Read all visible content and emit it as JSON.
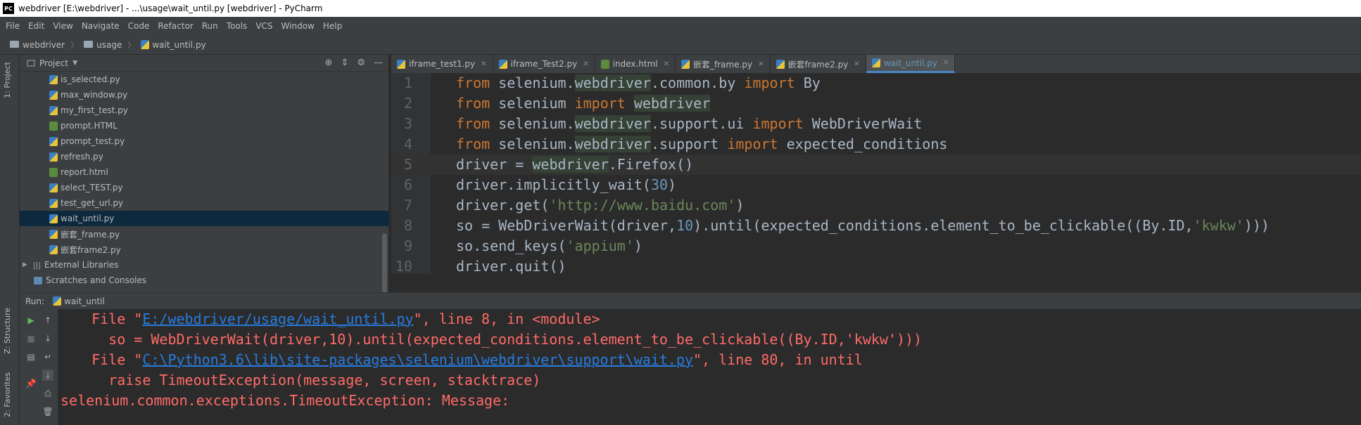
{
  "window": {
    "title": "webdriver [E:\\webdriver] - ...\\usage\\wait_until.py [webdriver] - PyCharm",
    "logo_text": "PC"
  },
  "menu": [
    "File",
    "Edit",
    "View",
    "Navigate",
    "Code",
    "Refactor",
    "Run",
    "Tools",
    "VCS",
    "Window",
    "Help"
  ],
  "breadcrumb": [
    "webdriver",
    "usage",
    "wait_until.py"
  ],
  "left_strip": {
    "project_tab": "1: Project",
    "structure_tab": "Z: Structure",
    "favorites_tab": "2: Favorites"
  },
  "project": {
    "title": "Project",
    "files": [
      {
        "name": "is_selected.py",
        "type": "py"
      },
      {
        "name": "max_window.py",
        "type": "py"
      },
      {
        "name": "my_first_test.py",
        "type": "py"
      },
      {
        "name": "prompt.HTML",
        "type": "html"
      },
      {
        "name": "prompt_test.py",
        "type": "py"
      },
      {
        "name": "refresh.py",
        "type": "py"
      },
      {
        "name": "report.html",
        "type": "html"
      },
      {
        "name": "select_TEST.py",
        "type": "py"
      },
      {
        "name": "test_get_url.py",
        "type": "py"
      },
      {
        "name": "wait_until.py",
        "type": "py",
        "selected": true
      },
      {
        "name": "嵌套_frame.py",
        "type": "py"
      },
      {
        "name": "嵌套frame2.py",
        "type": "py"
      }
    ],
    "external_libraries": "External Libraries",
    "scratches": "Scratches and Consoles"
  },
  "tabs": [
    {
      "label": "iframe_test1.py",
      "type": "py"
    },
    {
      "label": "iframe_Test2.py",
      "type": "py"
    },
    {
      "label": "index.html",
      "type": "html"
    },
    {
      "label": "嵌套_frame.py",
      "type": "py"
    },
    {
      "label": "嵌套frame2.py",
      "type": "py"
    },
    {
      "label": "wait_until.py",
      "type": "py",
      "active": true
    }
  ],
  "editor": {
    "current_line": 5,
    "lines": [
      "from selenium.webdriver.common.by import By",
      "from selenium import webdriver",
      "from selenium.webdriver.support.ui import WebDriverWait",
      "from selenium.webdriver.support import expected_conditions",
      "driver = webdriver.Firefox()",
      "driver.implicitly_wait(30)",
      "driver.get('http://www.baidu.com')",
      "so = WebDriverWait(driver,10).until(expected_conditions.element_to_be_clickable((By.ID,'kwkw')))",
      "so.send_keys('appium')",
      "driver.quit()"
    ]
  },
  "run": {
    "label": "Run:",
    "tab": "wait_until",
    "console": [
      {
        "prefix": "  File \"",
        "link": "E:/webdriver/usage/wait_until.py",
        "suffix": "\", line 8, in <module>"
      },
      {
        "text": "    so = WebDriverWait(driver,10).until(expected_conditions.element_to_be_clickable((By.ID,'kwkw')))"
      },
      {
        "prefix": "  File \"",
        "link": "C:\\Python3.6\\lib\\site-packages\\selenium\\webdriver\\support\\wait.py",
        "suffix": "\", line 80, in until"
      },
      {
        "text": "    raise TimeoutException(message, screen, stacktrace)"
      },
      {
        "text": "selenium.common.exceptions.TimeoutException: Message:"
      }
    ]
  },
  "colors": {
    "keyword": "#cc7832",
    "number": "#6897bb",
    "string": "#6a8759",
    "error": "#ff6b68",
    "link": "#287bde"
  }
}
